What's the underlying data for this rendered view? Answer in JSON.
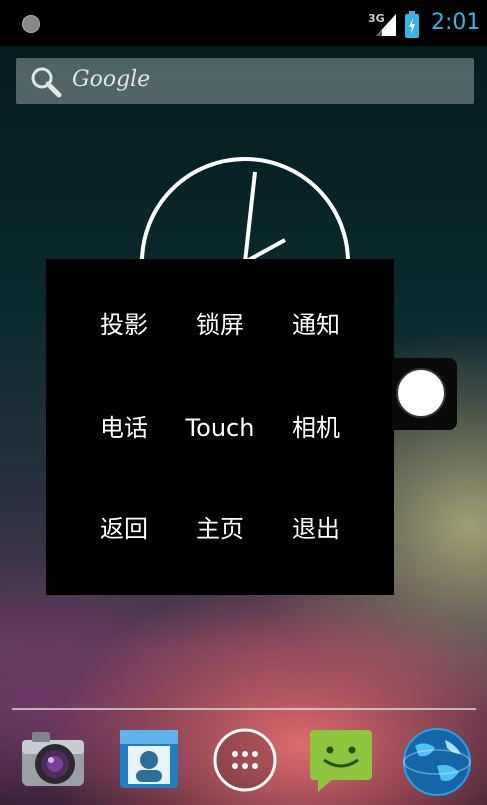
{
  "status_bar": {
    "network_label": "3G",
    "time": "2:01",
    "accent_color": "#33b5e5"
  },
  "search": {
    "placeholder": "Google",
    "icon": "search-icon"
  },
  "analog_clock": {
    "time": "2:01"
  },
  "floating_menu": {
    "items": [
      {
        "label": "投影"
      },
      {
        "label": "锁屏"
      },
      {
        "label": "通知"
      },
      {
        "label": "电话"
      },
      {
        "label": "Touch"
      },
      {
        "label": "相机"
      },
      {
        "label": "返回"
      },
      {
        "label": "主页"
      },
      {
        "label": "退出"
      }
    ]
  },
  "dock": {
    "apps": [
      {
        "icon": "camera-app-icon"
      },
      {
        "icon": "contacts-app-icon"
      },
      {
        "icon": "app-drawer-icon"
      },
      {
        "icon": "messaging-app-icon"
      },
      {
        "icon": "browser-globe-icon"
      }
    ]
  }
}
